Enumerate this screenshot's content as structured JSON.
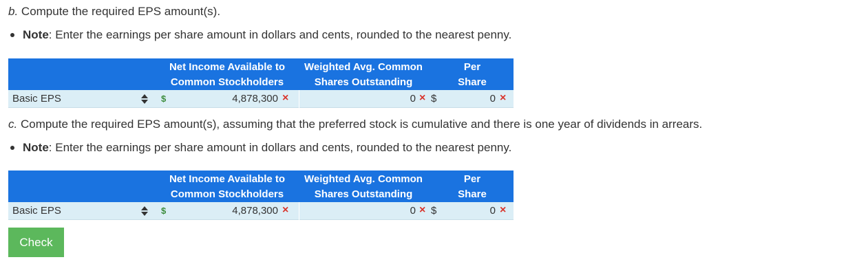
{
  "section_b": {
    "heading_prefix": "b.",
    "heading_text": " Compute the required EPS amount(s).",
    "note_label": "Note",
    "note_text": ": Enter the earnings per share amount in dollars and cents, rounded to the nearest penny.",
    "table": {
      "headers": {
        "net_income_line1": "Net Income Available to",
        "net_income_line2": "Common Stockholders",
        "weighted_line1": "Weighted Avg. Common",
        "weighted_line2": "Shares Outstanding",
        "per_share_line1": "Per",
        "per_share_line2": "Share"
      },
      "row": {
        "label": "Basic EPS",
        "net_income": "4,878,300",
        "weighted_avg": "0",
        "dollar_sign": "$",
        "per_share": "0"
      }
    }
  },
  "section_c": {
    "heading_prefix": "c.",
    "heading_text": " Compute the required EPS amount(s), assuming that the preferred stock is cumulative and there is one year of dividends in arrears.",
    "note_label": "Note",
    "note_text": ": Enter the earnings per share amount in dollars and cents, rounded to the nearest penny.",
    "table": {
      "headers": {
        "net_income_line1": "Net Income Available to",
        "net_income_line2": "Common Stockholders",
        "weighted_line1": "Weighted Avg. Common",
        "weighted_line2": "Shares Outstanding",
        "per_share_line1": "Per",
        "per_share_line2": "Share"
      },
      "row": {
        "label": "Basic EPS",
        "net_income": "4,878,300",
        "weighted_avg": "0",
        "dollar_sign": "$",
        "per_share": "0"
      }
    }
  },
  "check_button": {
    "label": "Check"
  },
  "icons": {
    "incorrect": "×",
    "money": "$"
  },
  "colors": {
    "header_bg": "#1a73e0",
    "row_bg": "#dbeef6",
    "incorrect": "#d9342b",
    "check_bg": "#5cb85c"
  }
}
